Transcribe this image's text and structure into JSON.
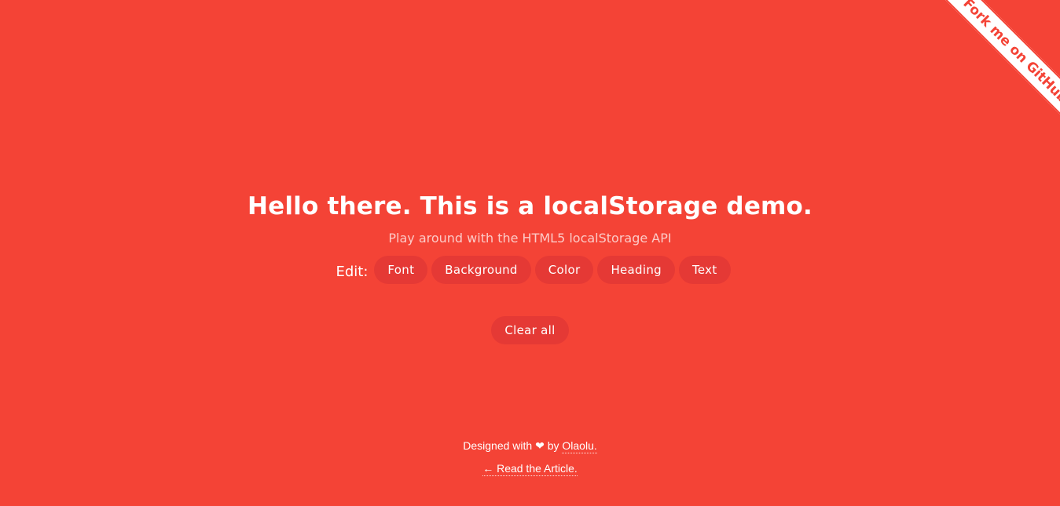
{
  "ribbon": {
    "label": "Fork me on GitHub"
  },
  "header": {
    "title": "Hello there. This is a localStorage demo.",
    "subtitle": "Play around with the HTML5 localStorage API"
  },
  "edit": {
    "label": "Edit:",
    "buttons": [
      "Font",
      "Background",
      "Color",
      "Heading",
      "Text"
    ]
  },
  "actions": {
    "clear_label": "Clear all"
  },
  "footer": {
    "designed_prefix": "Designed with",
    "heart_glyph": "❤",
    "by_text": "by",
    "author_link": "Olaolu.",
    "article_link": "← Read the Article."
  },
  "colors": {
    "background": "#f44336",
    "pill": "#e53935",
    "text": "#ffffff"
  },
  "icons": [
    "heart-icon",
    "left-arrow-icon"
  ]
}
